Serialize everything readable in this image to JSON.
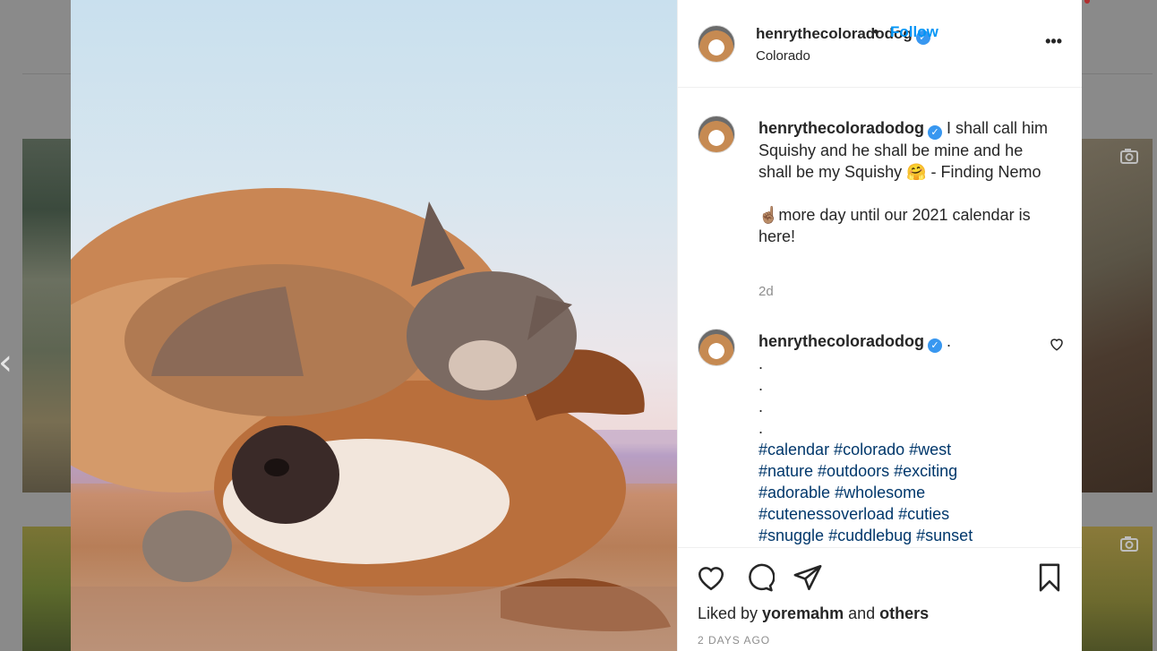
{
  "header": {
    "username": "henrythecoloradodog",
    "separator": "•",
    "follow_label": "Follow",
    "location": "Colorado",
    "more_label": "•••"
  },
  "caption": {
    "username": "henrythecoloradodog",
    "text_1": " I shall call him Squishy and he shall be mine and he shall be my Squishy 🤗 - Finding Nemo",
    "text_2": "☝🏽more day until our 2021 calendar is here!",
    "time": "2d"
  },
  "comment": {
    "username": "henrythecoloradodog",
    "first_line": " .",
    "dots": [
      ".",
      ".",
      ".",
      "."
    ],
    "hashtag_lines": [
      "#calendar #colorado #west",
      "#nature #outdoors #exciting",
      "#adorable #wholesome",
      "#cutenessoverload #cuties",
      "#snuggle #cuddlebug #sunset"
    ]
  },
  "footer": {
    "liked_prefix": "Liked by ",
    "liked_user": "yoremahm",
    "liked_and": " and ",
    "liked_others": "others",
    "timestamp": "2 DAYS AGO"
  },
  "navigation": {
    "prev_arrow": "‹"
  },
  "icons": {
    "header_more": "more-options-icon",
    "like": "heart-icon",
    "comment": "comment-bubble-icon",
    "share": "paper-plane-icon",
    "save": "bookmark-icon",
    "video_tile": "camera-icon"
  },
  "colors": {
    "follow": "#0095f6",
    "verified": "#3897f0",
    "hashtag": "#00376b",
    "muted": "#8e8e8e"
  }
}
